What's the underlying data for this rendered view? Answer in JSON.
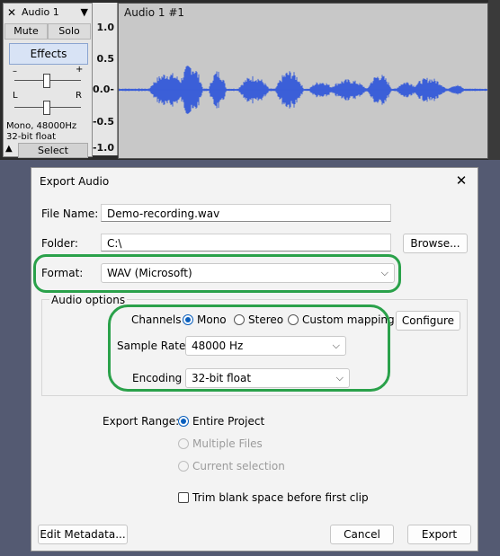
{
  "track": {
    "close_glyph": "✕",
    "name": "Audio 1",
    "menu_glyph": "▼",
    "mute_label": "Mute",
    "solo_label": "Solo",
    "effects_label": "Effects",
    "gain_minus": "–",
    "gain_plus": "+",
    "pan_left": "L",
    "pan_right": "R",
    "info_line1": "Mono, 48000Hz",
    "info_line2": "32-bit float",
    "collapse_glyph": "▲",
    "select_label": "Select",
    "clip_name": "Audio 1 #1",
    "ruler": [
      "1.0",
      "0.5",
      "0.0-",
      "-0.5",
      "-1.0"
    ],
    "wave_color": "#3b5fd8"
  },
  "dialog": {
    "title": "Export Audio",
    "close_glyph": "✕",
    "file_name_label": "File Name:",
    "file_name_value": "Demo-recording.wav",
    "folder_label": "Folder:",
    "folder_value": "C:\\",
    "browse_label": "Browse...",
    "format_label": "Format:",
    "format_value": "WAV (Microsoft)",
    "audio_options_label": "Audio options",
    "channels_label": "Channels",
    "channel_options": [
      "Mono",
      "Stereo",
      "Custom mapping"
    ],
    "channel_selected": "Mono",
    "configure_label": "Configure",
    "sample_rate_label": "Sample Rate",
    "sample_rate_value": "48000 Hz",
    "encoding_label": "Encoding",
    "encoding_value": "32-bit float",
    "export_range_label": "Export Range:",
    "range_options": [
      "Entire Project",
      "Multiple Files",
      "Current selection"
    ],
    "range_selected": "Entire Project",
    "trim_label": "Trim blank space before first clip",
    "trim_checked": false,
    "edit_metadata_label": "Edit Metadata...",
    "cancel_label": "Cancel",
    "export_label": "Export",
    "accent_color": "#0a5fbd",
    "annotation_color": "#2aa14a"
  }
}
